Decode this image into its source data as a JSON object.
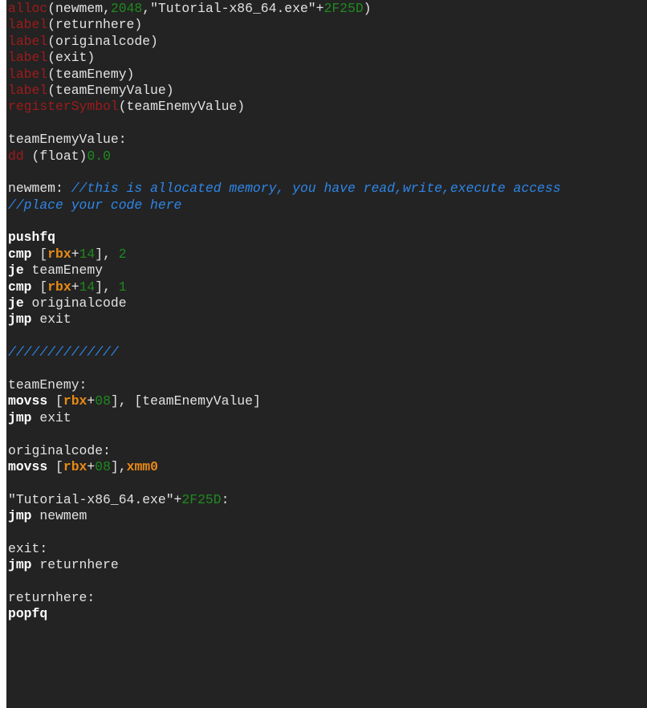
{
  "editor": {
    "lines": [
      [
        {
          "t": "alloc",
          "c": "kw"
        },
        {
          "t": "(newmem,",
          "c": "plain"
        },
        {
          "t": "2048",
          "c": "num"
        },
        {
          "t": ",\"Tutorial-x86_64.exe\"+",
          "c": "plain"
        },
        {
          "t": "2F25D",
          "c": "num"
        },
        {
          "t": ")",
          "c": "plain"
        }
      ],
      [
        {
          "t": "label",
          "c": "kw"
        },
        {
          "t": "(returnhere)",
          "c": "plain"
        }
      ],
      [
        {
          "t": "label",
          "c": "kw"
        },
        {
          "t": "(originalcode)",
          "c": "plain"
        }
      ],
      [
        {
          "t": "label",
          "c": "kw"
        },
        {
          "t": "(exit)",
          "c": "plain"
        }
      ],
      [
        {
          "t": "label",
          "c": "kw"
        },
        {
          "t": "(teamEnemy)",
          "c": "plain"
        }
      ],
      [
        {
          "t": "label",
          "c": "kw"
        },
        {
          "t": "(teamEnemyValue)",
          "c": "plain"
        }
      ],
      [
        {
          "t": "registerSymbol",
          "c": "kw"
        },
        {
          "t": "(teamEnemyValue)",
          "c": "plain"
        }
      ],
      [],
      [
        {
          "t": "teamEnemyValue:",
          "c": "plain"
        }
      ],
      [
        {
          "t": "dd",
          "c": "kw"
        },
        {
          "t": " (float)",
          "c": "plain"
        },
        {
          "t": "0.0",
          "c": "num"
        }
      ],
      [],
      [
        {
          "t": "newmem: ",
          "c": "plain"
        },
        {
          "t": "//this is allocated memory, you have read,write,execute access",
          "c": "cmt"
        }
      ],
      [
        {
          "t": "//place your code here",
          "c": "cmt"
        }
      ],
      [],
      [
        {
          "t": "pushfq",
          "c": "op"
        }
      ],
      [
        {
          "t": "cmp",
          "c": "op"
        },
        {
          "t": " [",
          "c": "plain"
        },
        {
          "t": "rbx",
          "c": "reg"
        },
        {
          "t": "+",
          "c": "plain"
        },
        {
          "t": "14",
          "c": "num"
        },
        {
          "t": "], ",
          "c": "plain"
        },
        {
          "t": "2",
          "c": "num"
        }
      ],
      [
        {
          "t": "je",
          "c": "op"
        },
        {
          "t": " teamEnemy",
          "c": "plain"
        }
      ],
      [
        {
          "t": "cmp",
          "c": "op"
        },
        {
          "t": " [",
          "c": "plain"
        },
        {
          "t": "rbx",
          "c": "reg"
        },
        {
          "t": "+",
          "c": "plain"
        },
        {
          "t": "14",
          "c": "num"
        },
        {
          "t": "], ",
          "c": "plain"
        },
        {
          "t": "1",
          "c": "num"
        }
      ],
      [
        {
          "t": "je",
          "c": "op"
        },
        {
          "t": " originalcode",
          "c": "plain"
        }
      ],
      [
        {
          "t": "jmp",
          "c": "op"
        },
        {
          "t": " exit",
          "c": "plain"
        }
      ],
      [],
      [
        {
          "t": "//////////////",
          "c": "cmt"
        }
      ],
      [],
      [
        {
          "t": "teamEnemy:",
          "c": "plain"
        }
      ],
      [
        {
          "t": "movss",
          "c": "op"
        },
        {
          "t": " [",
          "c": "plain"
        },
        {
          "t": "rbx",
          "c": "reg"
        },
        {
          "t": "+",
          "c": "plain"
        },
        {
          "t": "08",
          "c": "num"
        },
        {
          "t": "], [teamEnemyValue]",
          "c": "plain"
        }
      ],
      [
        {
          "t": "jmp",
          "c": "op"
        },
        {
          "t": " exit",
          "c": "plain"
        }
      ],
      [],
      [
        {
          "t": "originalcode:",
          "c": "plain"
        }
      ],
      [
        {
          "t": "movss",
          "c": "op"
        },
        {
          "t": " [",
          "c": "plain"
        },
        {
          "t": "rbx",
          "c": "reg"
        },
        {
          "t": "+",
          "c": "plain"
        },
        {
          "t": "08",
          "c": "num"
        },
        {
          "t": "],",
          "c": "plain"
        },
        {
          "t": "xmm0",
          "c": "reg"
        }
      ],
      [],
      [
        {
          "t": "\"Tutorial-x86_64.exe\"+",
          "c": "plain"
        },
        {
          "t": "2F25D",
          "c": "num"
        },
        {
          "t": ":",
          "c": "plain"
        }
      ],
      [
        {
          "t": "jmp",
          "c": "op"
        },
        {
          "t": " newmem",
          "c": "plain"
        }
      ],
      [],
      [
        {
          "t": "exit:",
          "c": "plain"
        }
      ],
      [
        {
          "t": "jmp",
          "c": "op"
        },
        {
          "t": " returnhere",
          "c": "plain"
        }
      ],
      [],
      [
        {
          "t": "returnhere:",
          "c": "plain"
        }
      ],
      [
        {
          "t": "popfq",
          "c": "op"
        }
      ]
    ]
  },
  "colors": {
    "background": "#232323",
    "keyword": "#9e1b1b",
    "number": "#1f8a1f",
    "comment": "#2e86e8",
    "register": "#e88a16",
    "text": "#e2e2e2"
  }
}
